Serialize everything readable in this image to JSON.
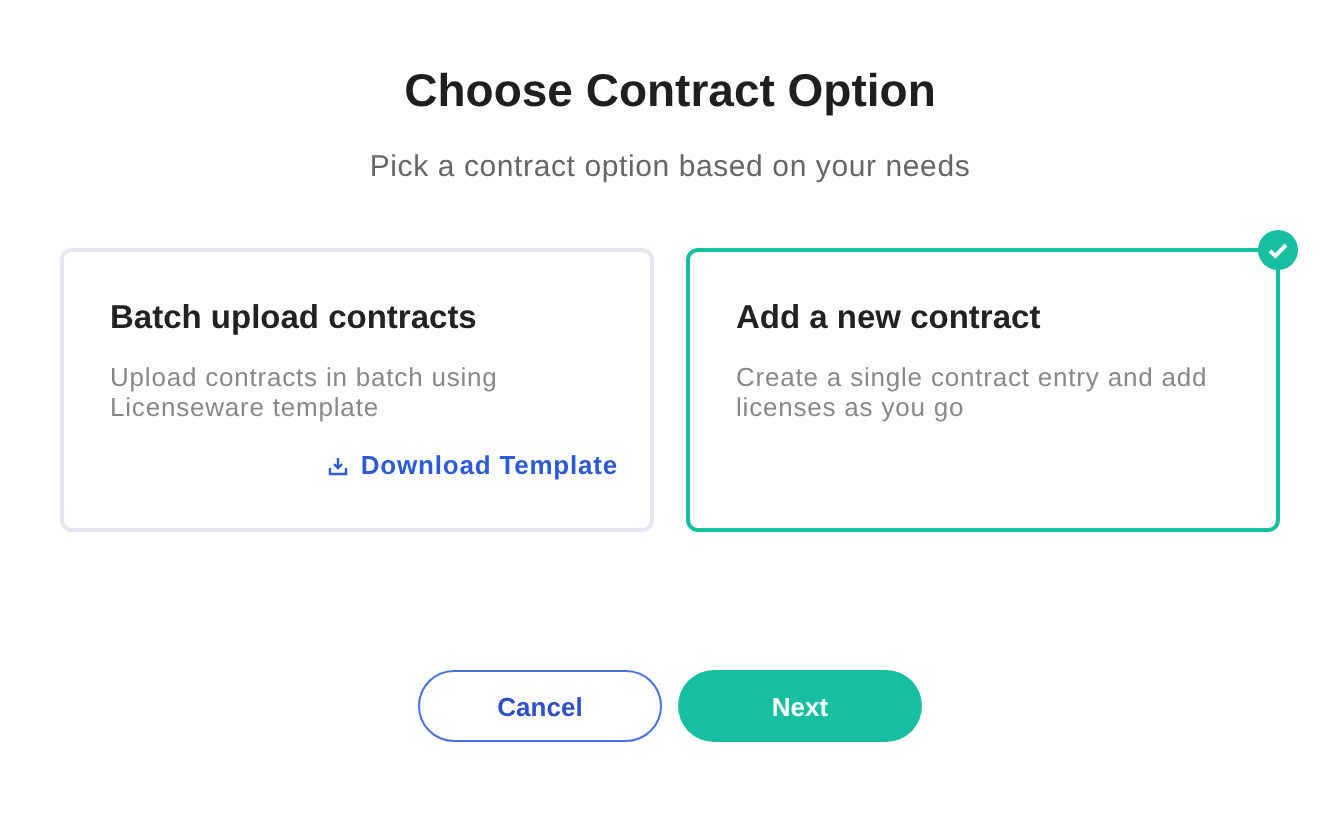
{
  "title": "Choose Contract Option",
  "subtitle": "Pick a contract option based on your needs",
  "options": [
    {
      "title": "Batch upload contracts",
      "description": "Upload contracts in batch using Licenseware template",
      "link": "Download Template",
      "selected": false
    },
    {
      "title": "Add a new contract",
      "description": "Create a single contract entry and add licenses as you go",
      "selected": true
    }
  ],
  "buttons": [
    {
      "label": "Cancel",
      "kind": "secondary"
    },
    {
      "label": "Next",
      "kind": "primary"
    }
  ]
}
